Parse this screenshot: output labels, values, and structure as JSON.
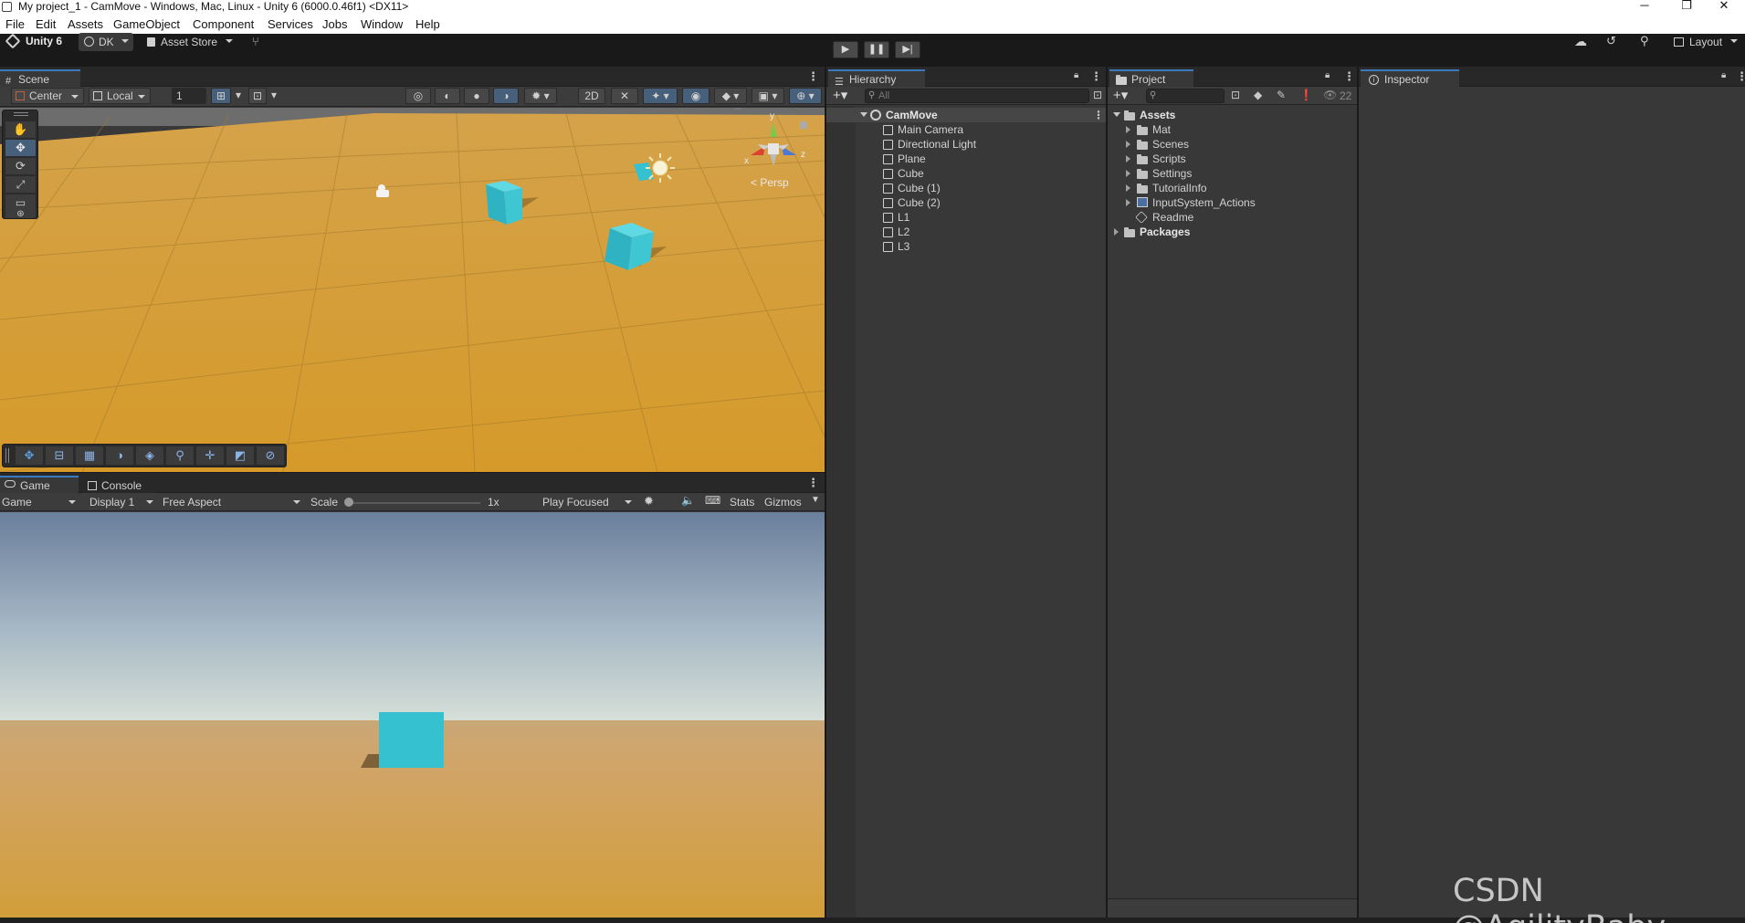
{
  "window": {
    "title": "My project_1 - CamMove - Windows, Mac, Linux - Unity 6 (6000.0.46f1) <DX11>",
    "minimize": "─",
    "maximize": "❐",
    "close": "✕"
  },
  "menu": [
    "File",
    "Edit",
    "Assets",
    "GameObject",
    "Component",
    "Services",
    "Jobs",
    "Window",
    "Help"
  ],
  "toolbar": {
    "unity_label": "Unity 6",
    "account_label": "DK",
    "asset_store_label": "Asset Store",
    "layout_label": "Layout"
  },
  "scene": {
    "tab": "Scene",
    "pivot": "Center",
    "space": "Local",
    "grid_value": "1",
    "persp_label": "Persp",
    "gizmo_y": "y",
    "gizmo_x": "x",
    "gizmo_z": "z"
  },
  "game": {
    "tab": "Game",
    "console_tab": "Console",
    "view_select": "Game",
    "display": "Display 1",
    "aspect": "Free Aspect",
    "scale_label": "Scale",
    "scale_value": "1x",
    "play_mode": "Play Focused",
    "stats": "Stats",
    "gizmos": "Gizmos"
  },
  "hierarchy": {
    "tab": "Hierarchy",
    "search_placeholder": "All",
    "scene_name": "CamMove",
    "items": [
      "Main Camera",
      "Directional Light",
      "Plane",
      "Cube",
      "Cube (1)",
      "Cube (2)",
      "L1",
      "L2",
      "L3"
    ]
  },
  "project": {
    "tab": "Project",
    "hidden_count": "22",
    "root": "Assets",
    "folders": [
      "Mat",
      "Scenes",
      "Scripts",
      "Settings",
      "TutorialInfo",
      "InputSystem_Actions"
    ],
    "readme": "Readme",
    "packages": "Packages"
  },
  "inspector": {
    "tab": "Inspector"
  },
  "watermark": "CSDN @AgilityBaby",
  "colors": {
    "accent": "#3a79bb",
    "cube": "#35c1cf",
    "ground": "#d29a33",
    "sky_top": "#6a7f9c"
  }
}
